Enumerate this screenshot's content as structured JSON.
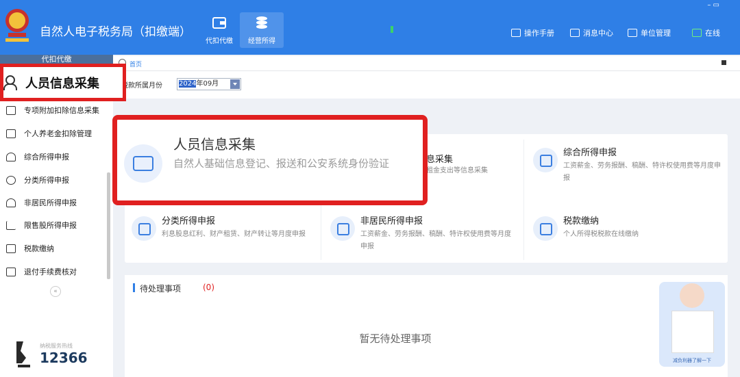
{
  "header": {
    "app_title": "自然人电子税务局（扣缴端）",
    "tabs": [
      {
        "label": "代扣代缴",
        "icon": "wallet-icon"
      },
      {
        "label": "经营所得",
        "icon": "coins-icon"
      }
    ],
    "right_links": [
      {
        "label": "操作手册",
        "icon": "manual-icon"
      },
      {
        "label": "消息中心",
        "icon": "mail-icon"
      },
      {
        "label": "单位管理",
        "icon": "building-icon"
      },
      {
        "label": "在线",
        "icon": "monitor-icon"
      }
    ],
    "window_controls": "– ▭"
  },
  "sidebar": {
    "header_label": "代扣代缴",
    "highlighted_item": {
      "label": "人员信息采集",
      "icon": "user-icon"
    },
    "items": [
      {
        "label": "专项附加扣除信息采集",
        "icon": "grid-list-icon"
      },
      {
        "label": "个人养老金扣除管理",
        "icon": "pension-icon"
      },
      {
        "label": "综合所得申报",
        "icon": "layers-icon"
      },
      {
        "label": "分类所得申报",
        "icon": "clock-icon"
      },
      {
        "label": "非居民所得申报",
        "icon": "person-icon"
      },
      {
        "label": "限售股所得申报",
        "icon": "bar-chart-icon"
      },
      {
        "label": "税款缴纳",
        "icon": "folder-icon"
      },
      {
        "label": "退付手续费核对",
        "icon": "document-icon"
      }
    ],
    "collapse_label": "«",
    "hotline_label": "纳税服务热线",
    "hotline_number": "12366"
  },
  "breadcrumb": {
    "home": "首页"
  },
  "period": {
    "label": "税款所属月份",
    "year": "2024",
    "rest": "年09月"
  },
  "feature": {
    "title": "人员信息采集",
    "desc": "自然人基础信息登记、报送和公安系统身份验证"
  },
  "cards": [
    {
      "title": "息采集",
      "desc": "租金支出等信息采集"
    },
    {
      "title": "综合所得申报",
      "desc": "工资薪金、劳务报酬、稿酬、特许权使用费等月度申报"
    },
    {
      "title": "分类所得申报",
      "desc": "利息股息红利、财产租赁、财产转让等月度申报"
    },
    {
      "title": "非居民所得申报",
      "desc": "工资薪金、劳务报酬、稿酬、特许权使用费等月度申报"
    },
    {
      "title": "税款缴纳",
      "desc": "个人所得税税款在线缴纳"
    }
  ],
  "pending": {
    "title": "待处理事项",
    "count": "(0)",
    "empty": "暂无待处理事项"
  },
  "qr": {
    "caption": "减负利器了解一下"
  },
  "colors": {
    "brand": "#2f7fe6",
    "highlight": "#e02020"
  }
}
